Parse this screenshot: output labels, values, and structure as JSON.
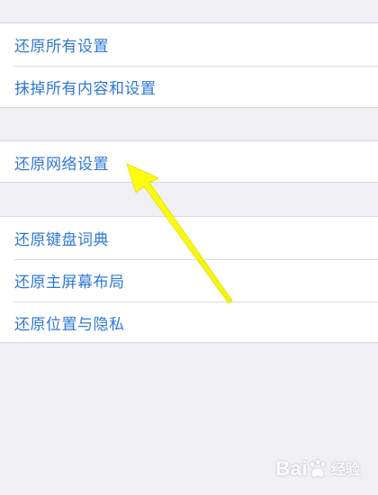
{
  "settings": {
    "group1": {
      "items": [
        {
          "label": "还原所有设置"
        },
        {
          "label": "抹掉所有内容和设置"
        }
      ]
    },
    "group2": {
      "items": [
        {
          "label": "还原网络设置"
        }
      ]
    },
    "group3": {
      "items": [
        {
          "label": "还原键盘词典"
        },
        {
          "label": "还原主屏幕布局"
        },
        {
          "label": "还原位置与隐私"
        }
      ]
    }
  },
  "annotation": {
    "arrow_color": "#ffff00",
    "target": "还原网络设置"
  },
  "watermark": {
    "brand_left": "Bai",
    "brand_right": "经验"
  },
  "colors": {
    "label": "#2f78d6",
    "background": "#efeff4",
    "cell": "#ffffff"
  }
}
